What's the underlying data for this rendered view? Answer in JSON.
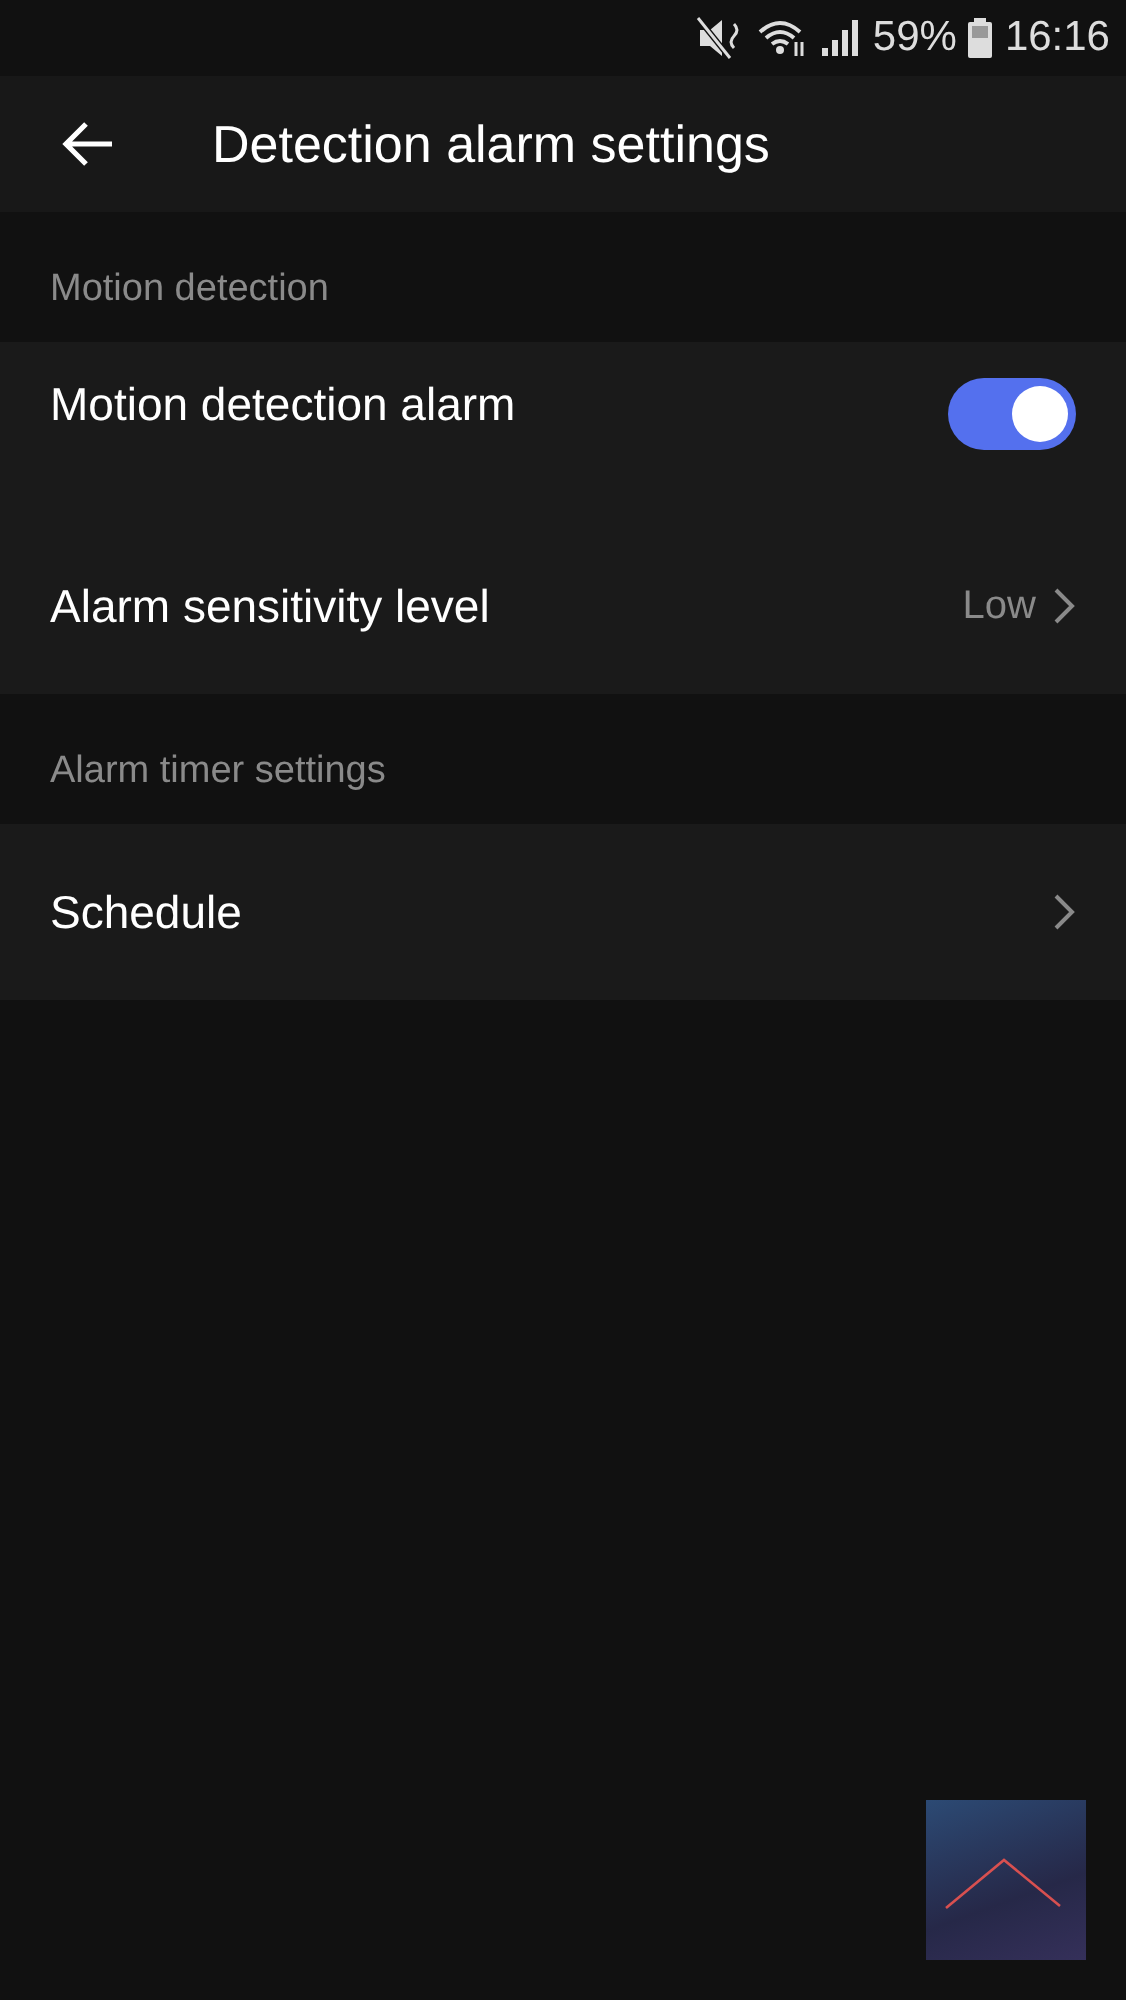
{
  "status_bar": {
    "battery": "59%",
    "time": "16:16"
  },
  "header": {
    "title": "Detection alarm settings"
  },
  "sections": [
    {
      "title": "Motion detection",
      "rows": [
        {
          "kind": "toggle",
          "label": "Motion detection alarm",
          "on": true
        },
        {
          "kind": "link",
          "label": "Alarm sensitivity level",
          "value": "Low"
        }
      ]
    },
    {
      "title": "Alarm timer settings",
      "rows": [
        {
          "kind": "link",
          "label": "Schedule"
        }
      ]
    }
  ]
}
